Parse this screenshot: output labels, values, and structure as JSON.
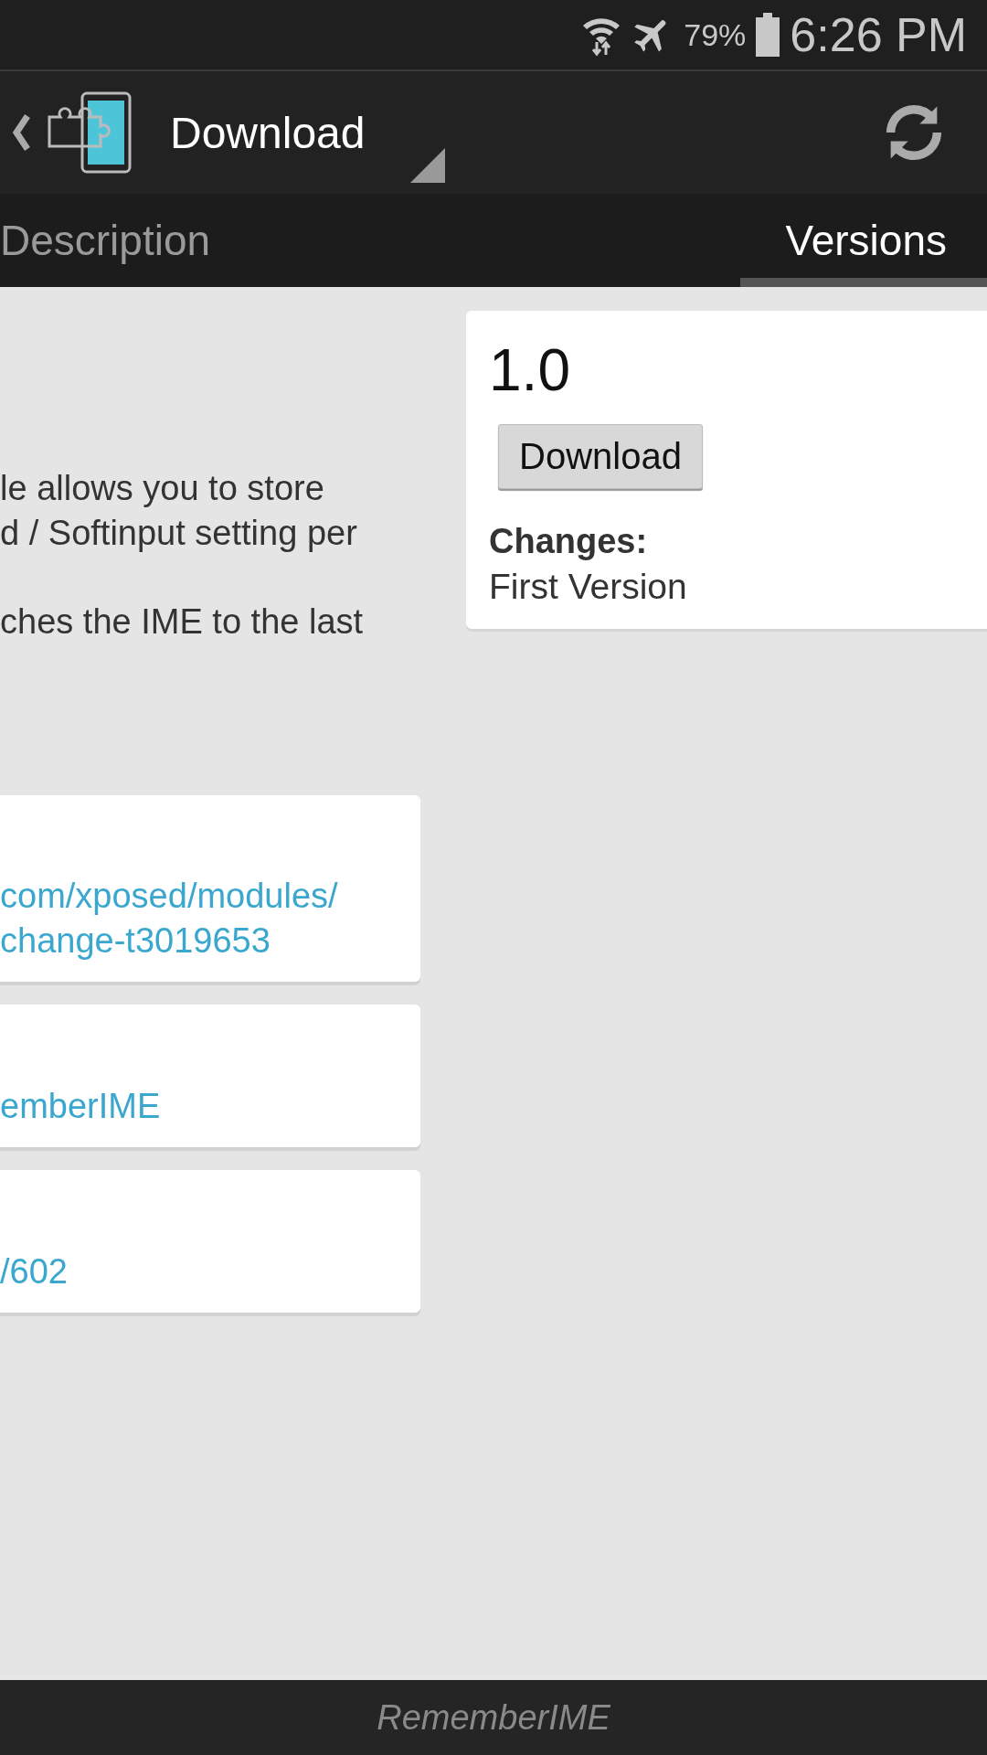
{
  "status_bar": {
    "battery": "79%",
    "time": "6:26 PM"
  },
  "action_bar": {
    "title": "Download"
  },
  "tabs": [
    {
      "label": "Description",
      "selected": false
    },
    {
      "label": "Versions",
      "selected": true
    }
  ],
  "description": {
    "paragraphs": [
      [
        "le allows you to store",
        "d / Softinput setting per"
      ],
      [
        "ches the IME to the last"
      ]
    ]
  },
  "link_cards": [
    {
      "lines": [
        "com/xposed/modules/",
        "change-t3019653"
      ]
    },
    {
      "lines": [
        "emberIME"
      ]
    },
    {
      "lines": [
        "/602"
      ]
    }
  ],
  "version_card": {
    "version": "1.0",
    "button": "Download",
    "changes_label": "Changes:",
    "changes": "First Version"
  },
  "footer": {
    "title": "RememberIME"
  }
}
